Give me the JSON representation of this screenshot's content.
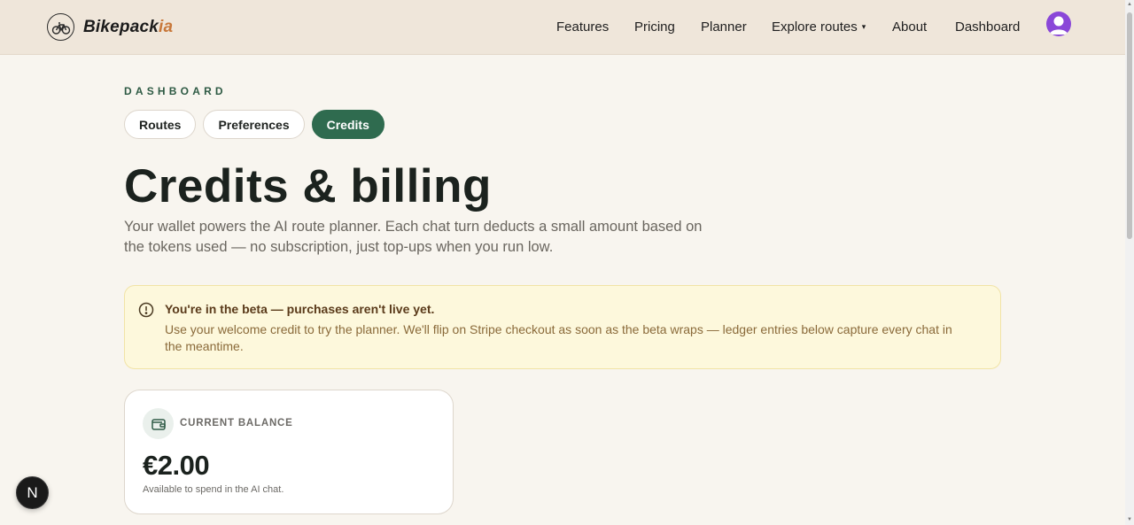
{
  "header": {
    "brand_main": "Bikepack",
    "brand_accent": "ia",
    "nav": {
      "features": "Features",
      "pricing": "Pricing",
      "planner": "Planner",
      "explore_routes": "Explore routes",
      "about": "About",
      "dashboard": "Dashboard"
    },
    "avatar_color": "#8a47d8"
  },
  "main": {
    "eyebrow": "DASHBOARD",
    "tabs": [
      {
        "label": "Routes",
        "active": false
      },
      {
        "label": "Preferences",
        "active": false
      },
      {
        "label": "Credits",
        "active": true
      }
    ],
    "title": "Credits & billing",
    "intro": "Your wallet powers the AI route planner. Each chat turn deducts a small amount based on the tokens used — no subscription, just top-ups when you run low.",
    "notice": {
      "title": "You're in the beta — purchases aren't live yet.",
      "body": "Use your welcome credit to try the planner. We'll flip on Stripe checkout as soon as the beta wraps — ledger entries below capture every chat in the meantime."
    },
    "balance": {
      "label": "CURRENT BALANCE",
      "value": "€2.00",
      "caption": "Available to spend in the AI chat."
    }
  },
  "floating_badge": "N",
  "colors": {
    "accent": "#2f6b4f",
    "header_bg": "#efe6da",
    "page_bg": "#f8f5ef",
    "notice_bg": "#fdf8dc"
  },
  "icons": [
    "bike-logo-icon",
    "chevron-down-icon",
    "alert-circle-icon",
    "wallet-icon",
    "user-avatar-icon"
  ]
}
